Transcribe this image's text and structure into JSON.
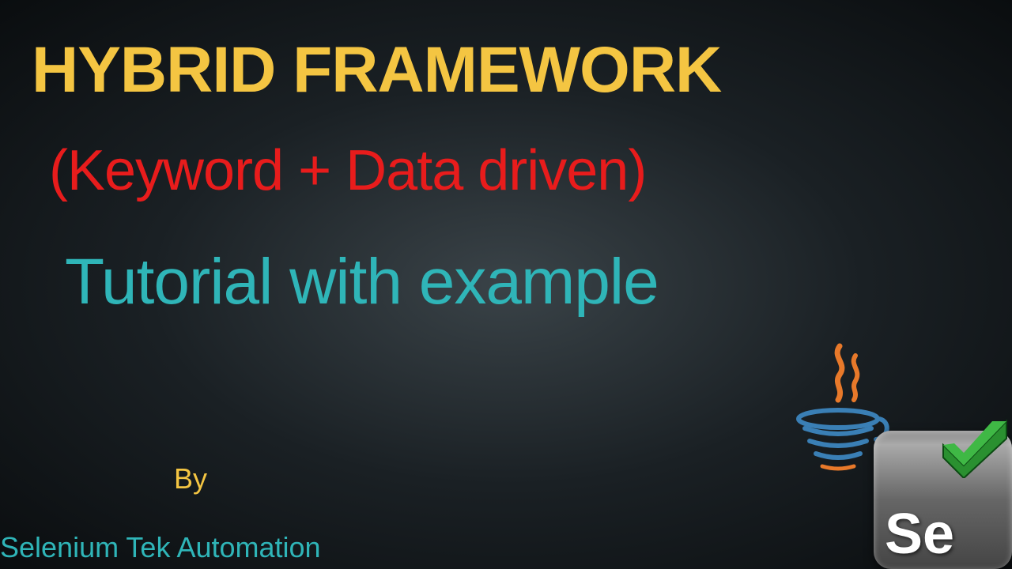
{
  "title": "HYBRID FRAMEWORK",
  "subtitle1": "(Keyword + Data driven)",
  "subtitle2": "Tutorial with example",
  "byLabel": "By",
  "author": "Selenium Tek Automation",
  "seleniumLogoText": "Se",
  "icons": {
    "java": "java-logo-icon",
    "selenium": "selenium-logo-icon",
    "checkmark": "checkmark-icon"
  },
  "colors": {
    "titleGold": "#f4c542",
    "subtitleRed": "#e81c1c",
    "subtitleTeal": "#2fb5b8"
  }
}
